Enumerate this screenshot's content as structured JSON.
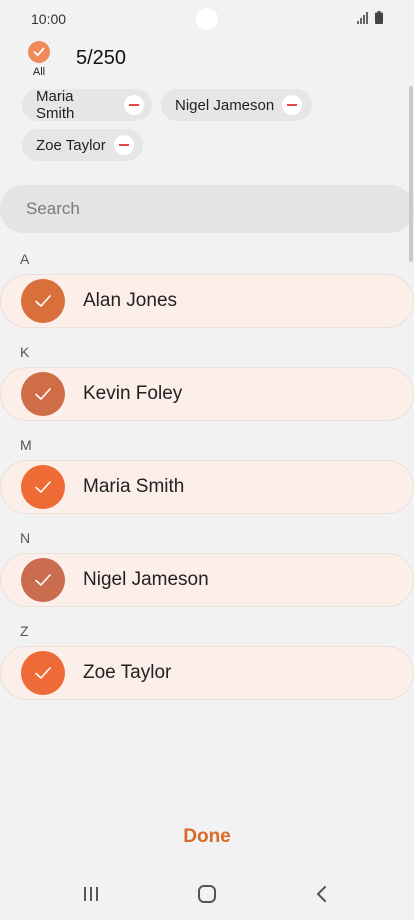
{
  "status_bar": {
    "time": "10:00"
  },
  "header": {
    "select_all_label": "All",
    "count": "5/250"
  },
  "selected_chips": [
    "Maria Smith",
    "Nigel Jameson",
    "Zoe Taylor"
  ],
  "search": {
    "placeholder": "Search"
  },
  "sections": [
    {
      "letter": "A",
      "contact": "Alan Jones",
      "avatar_color": "#d9703c"
    },
    {
      "letter": "K",
      "contact": "Kevin Foley",
      "avatar_color": "#cf6d47"
    },
    {
      "letter": "M",
      "contact": "Maria Smith",
      "avatar_color": "#ef6b35"
    },
    {
      "letter": "N",
      "contact": "Nigel Jameson",
      "avatar_color": "#c96c4f"
    },
    {
      "letter": "Z",
      "contact": "Zoe Taylor",
      "avatar_color": "#ee6a36"
    }
  ],
  "footer": {
    "done_label": "Done"
  },
  "colors": {
    "accent": "#d96a2c",
    "remove_red": "#e2444a",
    "row_bg": "#fcefe9"
  },
  "icons": [
    "signal-icon",
    "battery-icon",
    "check-icon",
    "remove-icon",
    "recents-icon",
    "home-icon",
    "back-icon"
  ]
}
